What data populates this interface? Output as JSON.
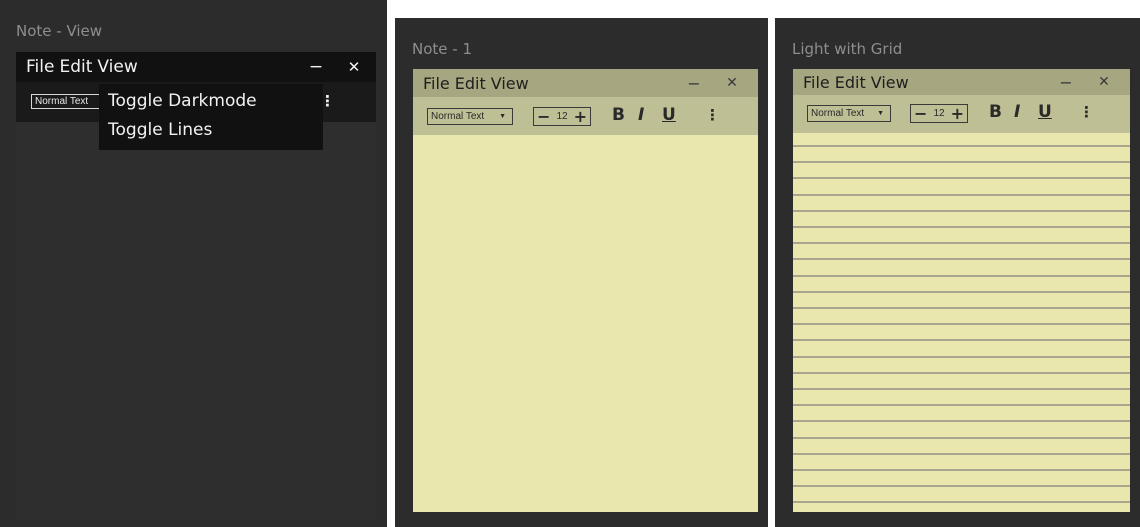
{
  "frames": [
    {
      "title": "Note - View",
      "theme": "dark",
      "menu": [
        "File",
        "Edit",
        "View"
      ],
      "window_buttons": {
        "minimize": "−",
        "close": "✕"
      },
      "toolbar": {
        "style_select": "Normal Text",
        "more": "⋮"
      },
      "view_menu_open": true,
      "dropdown_items": [
        "Toggle Darkmode",
        "Toggle Lines"
      ]
    },
    {
      "title": "Note - 1",
      "theme": "light",
      "menu": [
        "File",
        "Edit",
        "View"
      ],
      "window_buttons": {
        "minimize": "−",
        "close": "✕"
      },
      "toolbar": {
        "style_select": "Normal Text",
        "font_size": "12",
        "decrease": "−",
        "increase": "+",
        "bold": "B",
        "italic": "I",
        "underline": "U",
        "more": "⋮"
      },
      "lines": false
    },
    {
      "title": "Light with Grid",
      "theme": "light",
      "menu": [
        "File",
        "Edit",
        "View"
      ],
      "window_buttons": {
        "minimize": "−",
        "close": "✕"
      },
      "toolbar": {
        "style_select": "Normal Text",
        "font_size": "12",
        "decrease": "−",
        "increase": "+",
        "bold": "B",
        "italic": "I",
        "underline": "U",
        "more": "⋮"
      },
      "lines": true
    }
  ],
  "colors": {
    "frame_bg": "#2c2c2c",
    "dark_chrome": "#111111",
    "dark_page": "#2e2e2e",
    "light_menubar": "#a6a680",
    "light_toolbar": "#bfbf95",
    "light_page": "#e9e6ae",
    "ruled_line": "#a8a68e"
  }
}
